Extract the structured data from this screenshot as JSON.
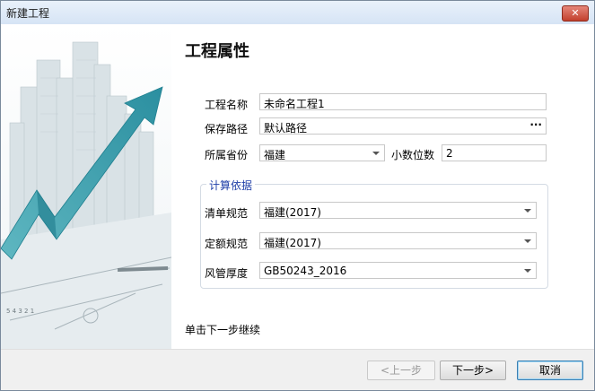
{
  "window": {
    "title": "新建工程",
    "close_label": "✕"
  },
  "page": {
    "heading": "工程属性",
    "hint": "单击下一步继续"
  },
  "form": {
    "project_name": {
      "label": "工程名称",
      "value": "未命名工程1"
    },
    "save_path": {
      "label": "保存路径",
      "value": "默认路径",
      "browse_label": "···"
    },
    "province": {
      "label": "所属省份",
      "value": "福建"
    },
    "decimals": {
      "label": "小数位数",
      "value": "2"
    }
  },
  "calc_basis": {
    "title": "计算依据",
    "bill_spec": {
      "label": "清单规范",
      "value": "福建(2017)"
    },
    "quota_spec": {
      "label": "定额规范",
      "value": "福建(2017)"
    },
    "duct_thickness": {
      "label": "风管厚度",
      "value": "GB50243_2016"
    }
  },
  "buttons": {
    "prev": "<上一步",
    "next": "下一步>",
    "cancel": "取消"
  },
  "colors": {
    "accent": "#1f3fa8",
    "arrow": "#3aa7b4"
  }
}
